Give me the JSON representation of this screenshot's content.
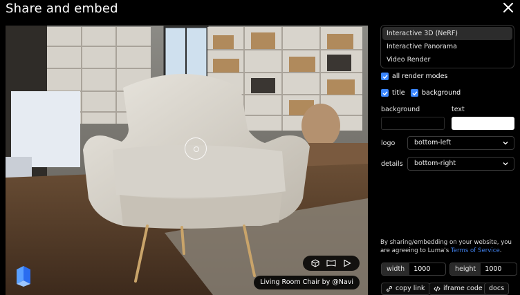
{
  "dialog": {
    "title": "Share and embed"
  },
  "preview": {
    "caption": "Living Room Chair by @Navi"
  },
  "modes": [
    {
      "label": "Interactive 3D (NeRF)",
      "selected": true
    },
    {
      "label": "Interactive Panorama",
      "selected": false
    },
    {
      "label": "Video Render",
      "selected": false
    }
  ],
  "options": {
    "all_render_modes": "all render modes",
    "title": "title",
    "background": "background"
  },
  "colors": {
    "background_label": "background",
    "background_value": "#000000",
    "text_label": "text",
    "text_value": "#ffffff",
    "accent": "#3a86ff"
  },
  "logo": {
    "label": "logo",
    "value": "bottom-left"
  },
  "details": {
    "label": "details",
    "value": "bottom-right"
  },
  "notice": {
    "text": "By sharing/embedding on your website, you are agreeing to Luma's",
    "link": "Terms of Service",
    "end": "."
  },
  "size": {
    "width_label": "width",
    "width_value": "1000",
    "height_label": "height",
    "height_value": "1000"
  },
  "actions": {
    "copy_link": "copy link",
    "iframe_code": "iframe code",
    "docs": "docs"
  }
}
